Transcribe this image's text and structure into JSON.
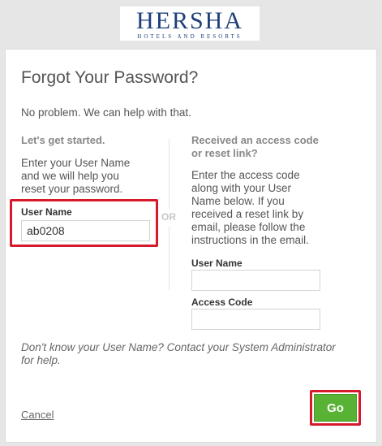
{
  "brand": {
    "name": "HERSHA",
    "tagline": "HOTELS AND RESORTS",
    "color": "#1c3f7a"
  },
  "page": {
    "title": "Forgot Your Password?",
    "intro": "No problem. We can help with that."
  },
  "left_column": {
    "heading": "Let's get started.",
    "instructions_lines": [
      "Enter your User Name",
      "and we will help you",
      "reset your password."
    ],
    "username_label": "User Name",
    "username_value": "ab0208"
  },
  "divider_label": "OR",
  "right_column": {
    "heading_lines": [
      "Received an access code",
      "or reset link?"
    ],
    "instructions_lines": [
      "Enter the access code",
      "along with your User",
      "Name below. If you",
      "received a reset link by",
      "email, please follow the",
      "instructions in the email."
    ],
    "username_label": "User Name",
    "username_value": "",
    "access_code_label": "Access Code",
    "access_code_value": ""
  },
  "help_lines": [
    "Don't know your User Name? Contact your System Administrator",
    "for help."
  ],
  "actions": {
    "cancel_label": "Cancel",
    "go_label": "Go"
  },
  "colors": {
    "highlight": "#d6192b",
    "go_button": "#58b233"
  }
}
